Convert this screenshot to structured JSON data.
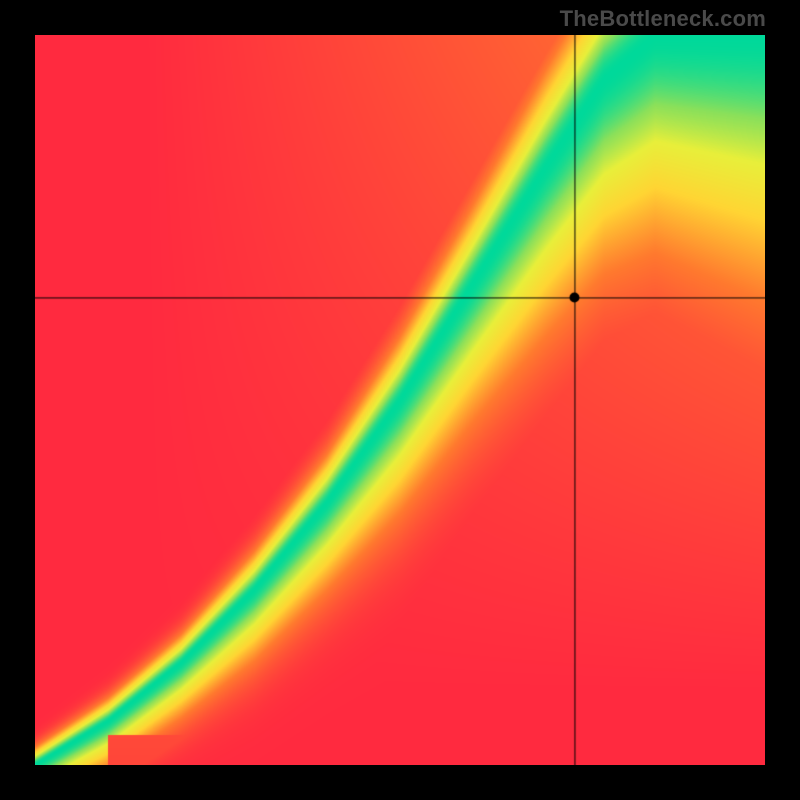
{
  "watermark": "TheBottleneck.com",
  "chart_data": {
    "type": "heatmap",
    "title": "",
    "xlabel": "",
    "ylabel": "",
    "xlim": [
      0,
      1
    ],
    "ylim": [
      0,
      1
    ],
    "grid": false,
    "legend": false,
    "color_stops": [
      {
        "t": 0.0,
        "color": "#ff2a3f"
      },
      {
        "t": 0.35,
        "color": "#ff7a2e"
      },
      {
        "t": 0.6,
        "color": "#ffd533"
      },
      {
        "t": 0.78,
        "color": "#e8ef3a"
      },
      {
        "t": 0.9,
        "color": "#8be05a"
      },
      {
        "t": 1.0,
        "color": "#00d99a"
      }
    ],
    "optimal_curve": {
      "description": "approximate green ridge y(x)",
      "points": [
        [
          0.0,
          0.0
        ],
        [
          0.1,
          0.06
        ],
        [
          0.2,
          0.14
        ],
        [
          0.3,
          0.24
        ],
        [
          0.4,
          0.36
        ],
        [
          0.5,
          0.5
        ],
        [
          0.6,
          0.66
        ],
        [
          0.7,
          0.82
        ],
        [
          0.78,
          0.94
        ],
        [
          0.85,
          1.0
        ]
      ]
    },
    "halfwidth": {
      "description": "green band half-width as fraction of y-axis, vs x",
      "points": [
        [
          0.0,
          0.005
        ],
        [
          0.2,
          0.012
        ],
        [
          0.4,
          0.025
        ],
        [
          0.6,
          0.045
        ],
        [
          0.8,
          0.07
        ],
        [
          1.0,
          0.095
        ]
      ]
    },
    "crosshair": {
      "x": 0.74,
      "y": 0.64
    },
    "marker": {
      "x": 0.74,
      "y": 0.64,
      "radius_px": 5
    },
    "background_corners": {
      "top_left": "#ff2a3f",
      "top_right": "#ffd84a",
      "bottom_left": "#ff2a3f",
      "bottom_right": "#ff2a3f"
    }
  }
}
